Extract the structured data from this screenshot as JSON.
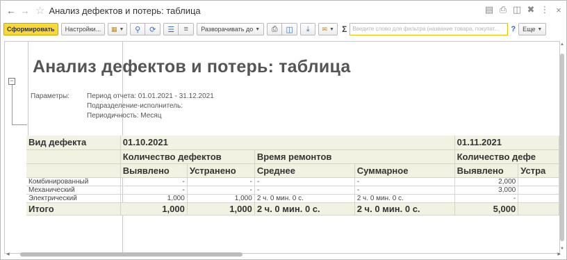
{
  "window": {
    "title": "Анализ дефектов и потерь: таблица"
  },
  "toolbar": {
    "generate_label": "Сформировать",
    "settings_label": "Настройки...",
    "expand_label": "Разворачивать до",
    "filter_placeholder": "Введите слово для фильтра (название товара, покупат...",
    "help_label": "?",
    "more_label": "Еще"
  },
  "report": {
    "title": "Анализ дефектов и потерь: таблица",
    "params_label": "Параметры:",
    "params": [
      "Период отчета: 01.01.2021 - 31.12.2021",
      "Подразделение-исполнитель:",
      "Периодичность: Месяц"
    ],
    "table": {
      "dim_header": "Вид дефекта",
      "periods": [
        "01.10.2021",
        "01.11.2021"
      ],
      "groups": [
        "Количество дефектов",
        "Время ремонтов",
        "Количество дефе"
      ],
      "subheaders": [
        "Выявлено",
        "Устранено",
        "Среднее",
        "Суммарное",
        "Выявлено",
        "Устра"
      ],
      "rows": [
        {
          "name": "Комбинированный",
          "c1": "-",
          "c2": "-",
          "c3": "-",
          "c4": "-",
          "c5": "2,000",
          "c6": ""
        },
        {
          "name": "Механический",
          "c1": "-",
          "c2": "-",
          "c3": "-",
          "c4": "-",
          "c5": "3,000",
          "c6": ""
        },
        {
          "name": "Электрический",
          "c1": "1,000",
          "c2": "1,000",
          "c3": "2 ч. 0 мин. 0 с.",
          "c4": "2 ч. 0 мин. 0 с.",
          "c5": "-",
          "c6": ""
        }
      ],
      "total": {
        "name": "Итого",
        "c1": "1,000",
        "c2": "1,000",
        "c3": "2 ч. 0 мин. 0 с.",
        "c4": "2 ч. 0 мин. 0 с.",
        "c5": "5,000",
        "c6": ""
      }
    }
  }
}
